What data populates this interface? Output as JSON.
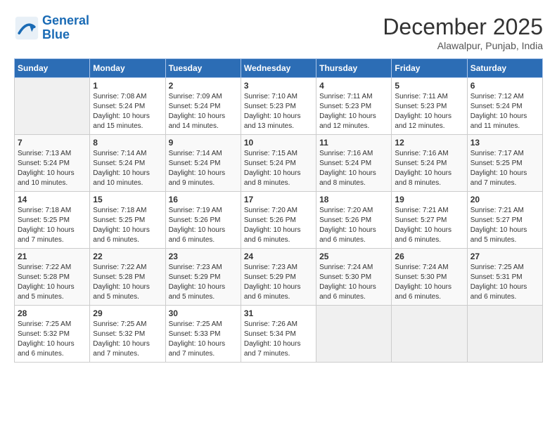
{
  "logo": {
    "line1": "General",
    "line2": "Blue"
  },
  "title": "December 2025",
  "location": "Alawalpur, Punjab, India",
  "headers": [
    "Sunday",
    "Monday",
    "Tuesday",
    "Wednesday",
    "Thursday",
    "Friday",
    "Saturday"
  ],
  "weeks": [
    [
      {
        "day": "",
        "info": ""
      },
      {
        "day": "1",
        "info": "Sunrise: 7:08 AM\nSunset: 5:24 PM\nDaylight: 10 hours\nand 15 minutes."
      },
      {
        "day": "2",
        "info": "Sunrise: 7:09 AM\nSunset: 5:24 PM\nDaylight: 10 hours\nand 14 minutes."
      },
      {
        "day": "3",
        "info": "Sunrise: 7:10 AM\nSunset: 5:23 PM\nDaylight: 10 hours\nand 13 minutes."
      },
      {
        "day": "4",
        "info": "Sunrise: 7:11 AM\nSunset: 5:23 PM\nDaylight: 10 hours\nand 12 minutes."
      },
      {
        "day": "5",
        "info": "Sunrise: 7:11 AM\nSunset: 5:23 PM\nDaylight: 10 hours\nand 12 minutes."
      },
      {
        "day": "6",
        "info": "Sunrise: 7:12 AM\nSunset: 5:24 PM\nDaylight: 10 hours\nand 11 minutes."
      }
    ],
    [
      {
        "day": "7",
        "info": "Sunrise: 7:13 AM\nSunset: 5:24 PM\nDaylight: 10 hours\nand 10 minutes."
      },
      {
        "day": "8",
        "info": "Sunrise: 7:14 AM\nSunset: 5:24 PM\nDaylight: 10 hours\nand 10 minutes."
      },
      {
        "day": "9",
        "info": "Sunrise: 7:14 AM\nSunset: 5:24 PM\nDaylight: 10 hours\nand 9 minutes."
      },
      {
        "day": "10",
        "info": "Sunrise: 7:15 AM\nSunset: 5:24 PM\nDaylight: 10 hours\nand 8 minutes."
      },
      {
        "day": "11",
        "info": "Sunrise: 7:16 AM\nSunset: 5:24 PM\nDaylight: 10 hours\nand 8 minutes."
      },
      {
        "day": "12",
        "info": "Sunrise: 7:16 AM\nSunset: 5:24 PM\nDaylight: 10 hours\nand 8 minutes."
      },
      {
        "day": "13",
        "info": "Sunrise: 7:17 AM\nSunset: 5:25 PM\nDaylight: 10 hours\nand 7 minutes."
      }
    ],
    [
      {
        "day": "14",
        "info": "Sunrise: 7:18 AM\nSunset: 5:25 PM\nDaylight: 10 hours\nand 7 minutes."
      },
      {
        "day": "15",
        "info": "Sunrise: 7:18 AM\nSunset: 5:25 PM\nDaylight: 10 hours\nand 6 minutes."
      },
      {
        "day": "16",
        "info": "Sunrise: 7:19 AM\nSunset: 5:26 PM\nDaylight: 10 hours\nand 6 minutes."
      },
      {
        "day": "17",
        "info": "Sunrise: 7:20 AM\nSunset: 5:26 PM\nDaylight: 10 hours\nand 6 minutes."
      },
      {
        "day": "18",
        "info": "Sunrise: 7:20 AM\nSunset: 5:26 PM\nDaylight: 10 hours\nand 6 minutes."
      },
      {
        "day": "19",
        "info": "Sunrise: 7:21 AM\nSunset: 5:27 PM\nDaylight: 10 hours\nand 6 minutes."
      },
      {
        "day": "20",
        "info": "Sunrise: 7:21 AM\nSunset: 5:27 PM\nDaylight: 10 hours\nand 5 minutes."
      }
    ],
    [
      {
        "day": "21",
        "info": "Sunrise: 7:22 AM\nSunset: 5:28 PM\nDaylight: 10 hours\nand 5 minutes."
      },
      {
        "day": "22",
        "info": "Sunrise: 7:22 AM\nSunset: 5:28 PM\nDaylight: 10 hours\nand 5 minutes."
      },
      {
        "day": "23",
        "info": "Sunrise: 7:23 AM\nSunset: 5:29 PM\nDaylight: 10 hours\nand 5 minutes."
      },
      {
        "day": "24",
        "info": "Sunrise: 7:23 AM\nSunset: 5:29 PM\nDaylight: 10 hours\nand 6 minutes."
      },
      {
        "day": "25",
        "info": "Sunrise: 7:24 AM\nSunset: 5:30 PM\nDaylight: 10 hours\nand 6 minutes."
      },
      {
        "day": "26",
        "info": "Sunrise: 7:24 AM\nSunset: 5:30 PM\nDaylight: 10 hours\nand 6 minutes."
      },
      {
        "day": "27",
        "info": "Sunrise: 7:25 AM\nSunset: 5:31 PM\nDaylight: 10 hours\nand 6 minutes."
      }
    ],
    [
      {
        "day": "28",
        "info": "Sunrise: 7:25 AM\nSunset: 5:32 PM\nDaylight: 10 hours\nand 6 minutes."
      },
      {
        "day": "29",
        "info": "Sunrise: 7:25 AM\nSunset: 5:32 PM\nDaylight: 10 hours\nand 7 minutes."
      },
      {
        "day": "30",
        "info": "Sunrise: 7:25 AM\nSunset: 5:33 PM\nDaylight: 10 hours\nand 7 minutes."
      },
      {
        "day": "31",
        "info": "Sunrise: 7:26 AM\nSunset: 5:34 PM\nDaylight: 10 hours\nand 7 minutes."
      },
      {
        "day": "",
        "info": ""
      },
      {
        "day": "",
        "info": ""
      },
      {
        "day": "",
        "info": ""
      }
    ]
  ]
}
